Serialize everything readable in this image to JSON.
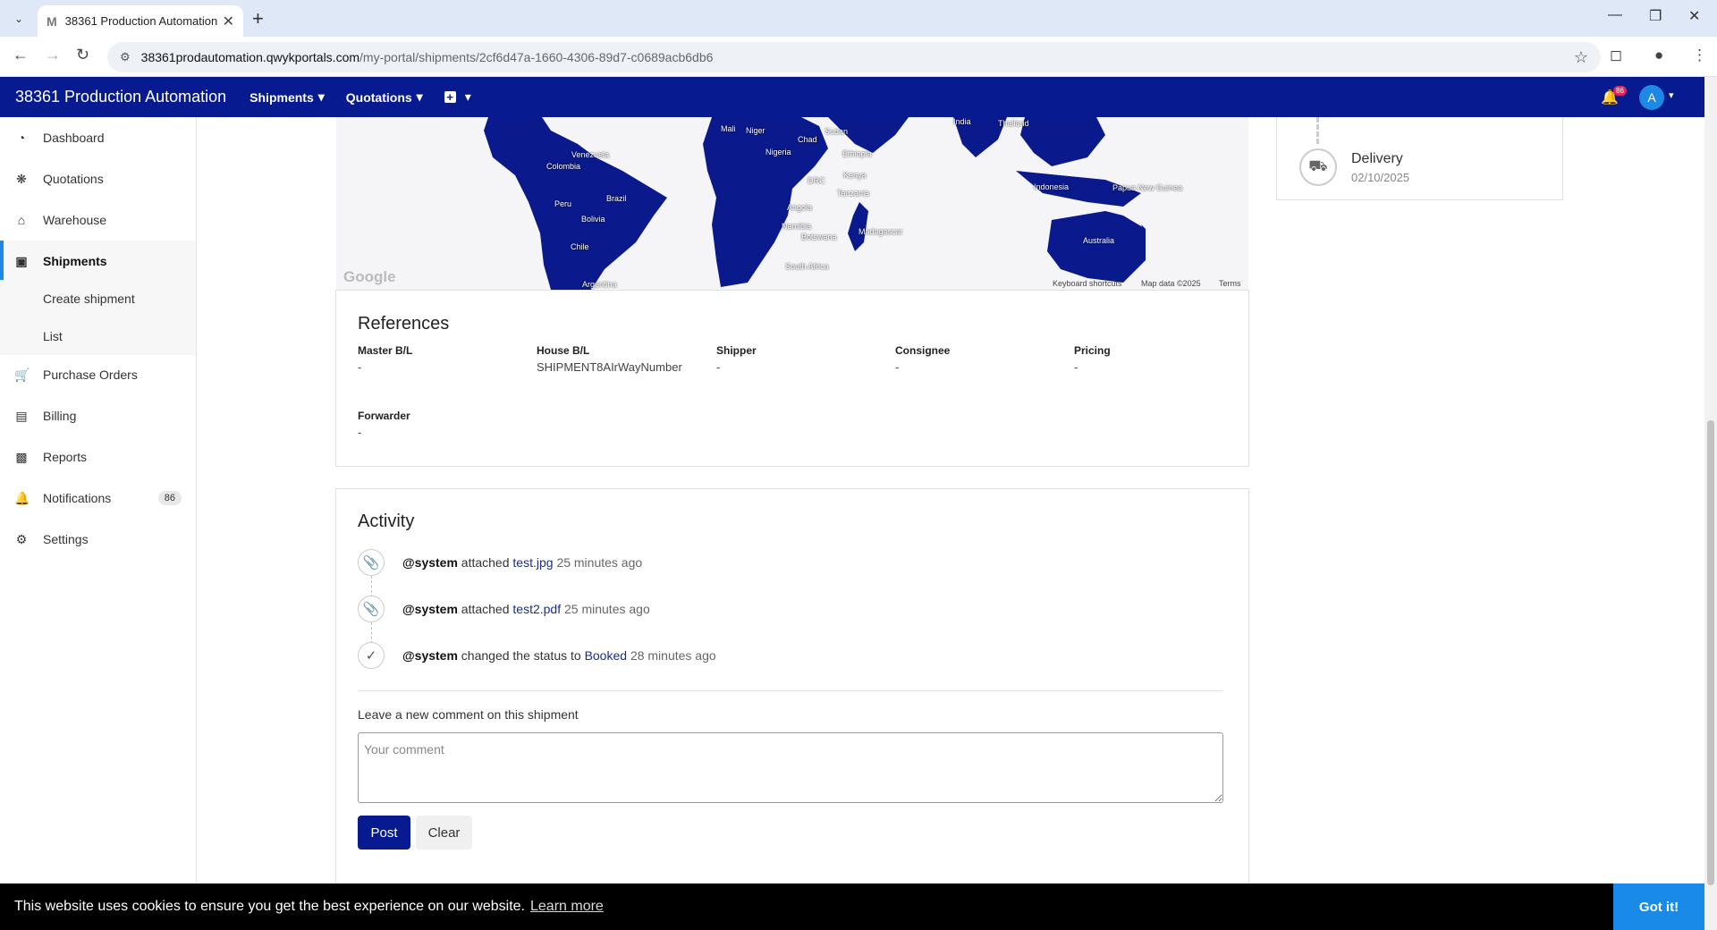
{
  "browser": {
    "tab_title": "38361 Production Automation",
    "favicon_text": "M",
    "url_host": "38361prodautomation.qwykportals.com",
    "url_path": "/my-portal/shipments/2cf6d47a-1660-4306-89d7-c0689acb6db6"
  },
  "header": {
    "brand": "38361 Production Automation",
    "nav": [
      "Shipments",
      "Quotations"
    ],
    "notification_count": "86",
    "avatar_initial": "A"
  },
  "sidebar": {
    "items": [
      {
        "label": "Dashboard",
        "icon": "dashboard-icon"
      },
      {
        "label": "Quotations",
        "icon": "quotations-icon"
      },
      {
        "label": "Warehouse",
        "icon": "warehouse-icon"
      },
      {
        "label": "Shipments",
        "icon": "shipments-icon"
      },
      {
        "label": "Purchase Orders",
        "icon": "cart-icon"
      },
      {
        "label": "Billing",
        "icon": "billing-icon"
      },
      {
        "label": "Reports",
        "icon": "reports-icon"
      },
      {
        "label": "Notifications",
        "icon": "bell-icon",
        "count": "86"
      },
      {
        "label": "Settings",
        "icon": "gear-icon"
      }
    ],
    "shipments_sub": [
      "Create shipment",
      "List"
    ]
  },
  "map": {
    "labels": [
      "Niger",
      "Mali",
      "Chad",
      "Sudan",
      "Nigeria",
      "Ethiopia",
      "India",
      "Thailand",
      "Venezuela",
      "Colombia",
      "DRC",
      "Kenya",
      "Tanzania",
      "Peru",
      "Brazil",
      "Bolivia",
      "Angola",
      "Namibia",
      "Botswana",
      "Madagascar",
      "Chile",
      "South Africa",
      "Argentina",
      "Indonesia",
      "Papua New Guinea",
      "Australia"
    ],
    "attribution": {
      "google": "Google",
      "shortcuts": "Keyboard shortcuts",
      "data": "Map data ©2025",
      "terms": "Terms"
    }
  },
  "delivery": {
    "title": "Delivery",
    "date": "02/10/2025"
  },
  "references": {
    "title": "References",
    "fields": [
      {
        "label": "Master B/L",
        "value": "-"
      },
      {
        "label": "House B/L",
        "value": "SHIPMENT8AIrWayNumber"
      },
      {
        "label": "Shipper",
        "value": "-"
      },
      {
        "label": "Consignee",
        "value": "-"
      },
      {
        "label": "Pricing",
        "value": "-"
      },
      {
        "label": "Forwarder",
        "value": "-"
      }
    ]
  },
  "activity": {
    "title": "Activity",
    "entries": [
      {
        "user": "@system",
        "action": "attached",
        "target": "test.jpg",
        "time": "25 minutes ago",
        "icon": "paperclip-icon"
      },
      {
        "user": "@system",
        "action": "attached",
        "target": "test2.pdf",
        "time": "25 minutes ago",
        "icon": "paperclip-icon"
      },
      {
        "user": "@system",
        "action": "changed the status to",
        "target": "Booked",
        "time": "28 minutes ago",
        "icon": "check-icon"
      }
    ],
    "comment_label": "Leave a new comment on this shipment",
    "comment_placeholder": "Your comment",
    "post_label": "Post",
    "clear_label": "Clear"
  },
  "cookie": {
    "message": "This website uses cookies to ensure you get the best experience on our website.",
    "learn_more": "Learn more",
    "button": "Got it!"
  }
}
